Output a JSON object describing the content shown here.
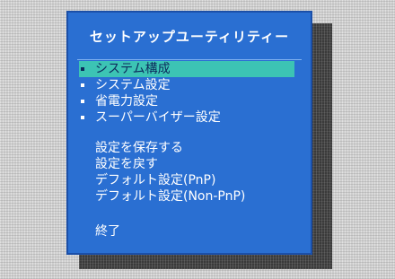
{
  "title": "セットアップユーティリティー",
  "menu": [
    {
      "label": "システム構成",
      "selected": true
    },
    {
      "label": "システム設定",
      "selected": false
    },
    {
      "label": "省電力設定",
      "selected": false
    },
    {
      "label": "スーパーバイザー設定",
      "selected": false
    }
  ],
  "actions": [
    "設定を保存する",
    "設定を戻す",
    "デフォルト設定(PnP)",
    "デフォルト設定(Non-PnP)"
  ],
  "exit_label": "終了",
  "colors": {
    "panel": "#2a6fd2",
    "selection": "#3cc4b4",
    "text": "#ffffff"
  }
}
